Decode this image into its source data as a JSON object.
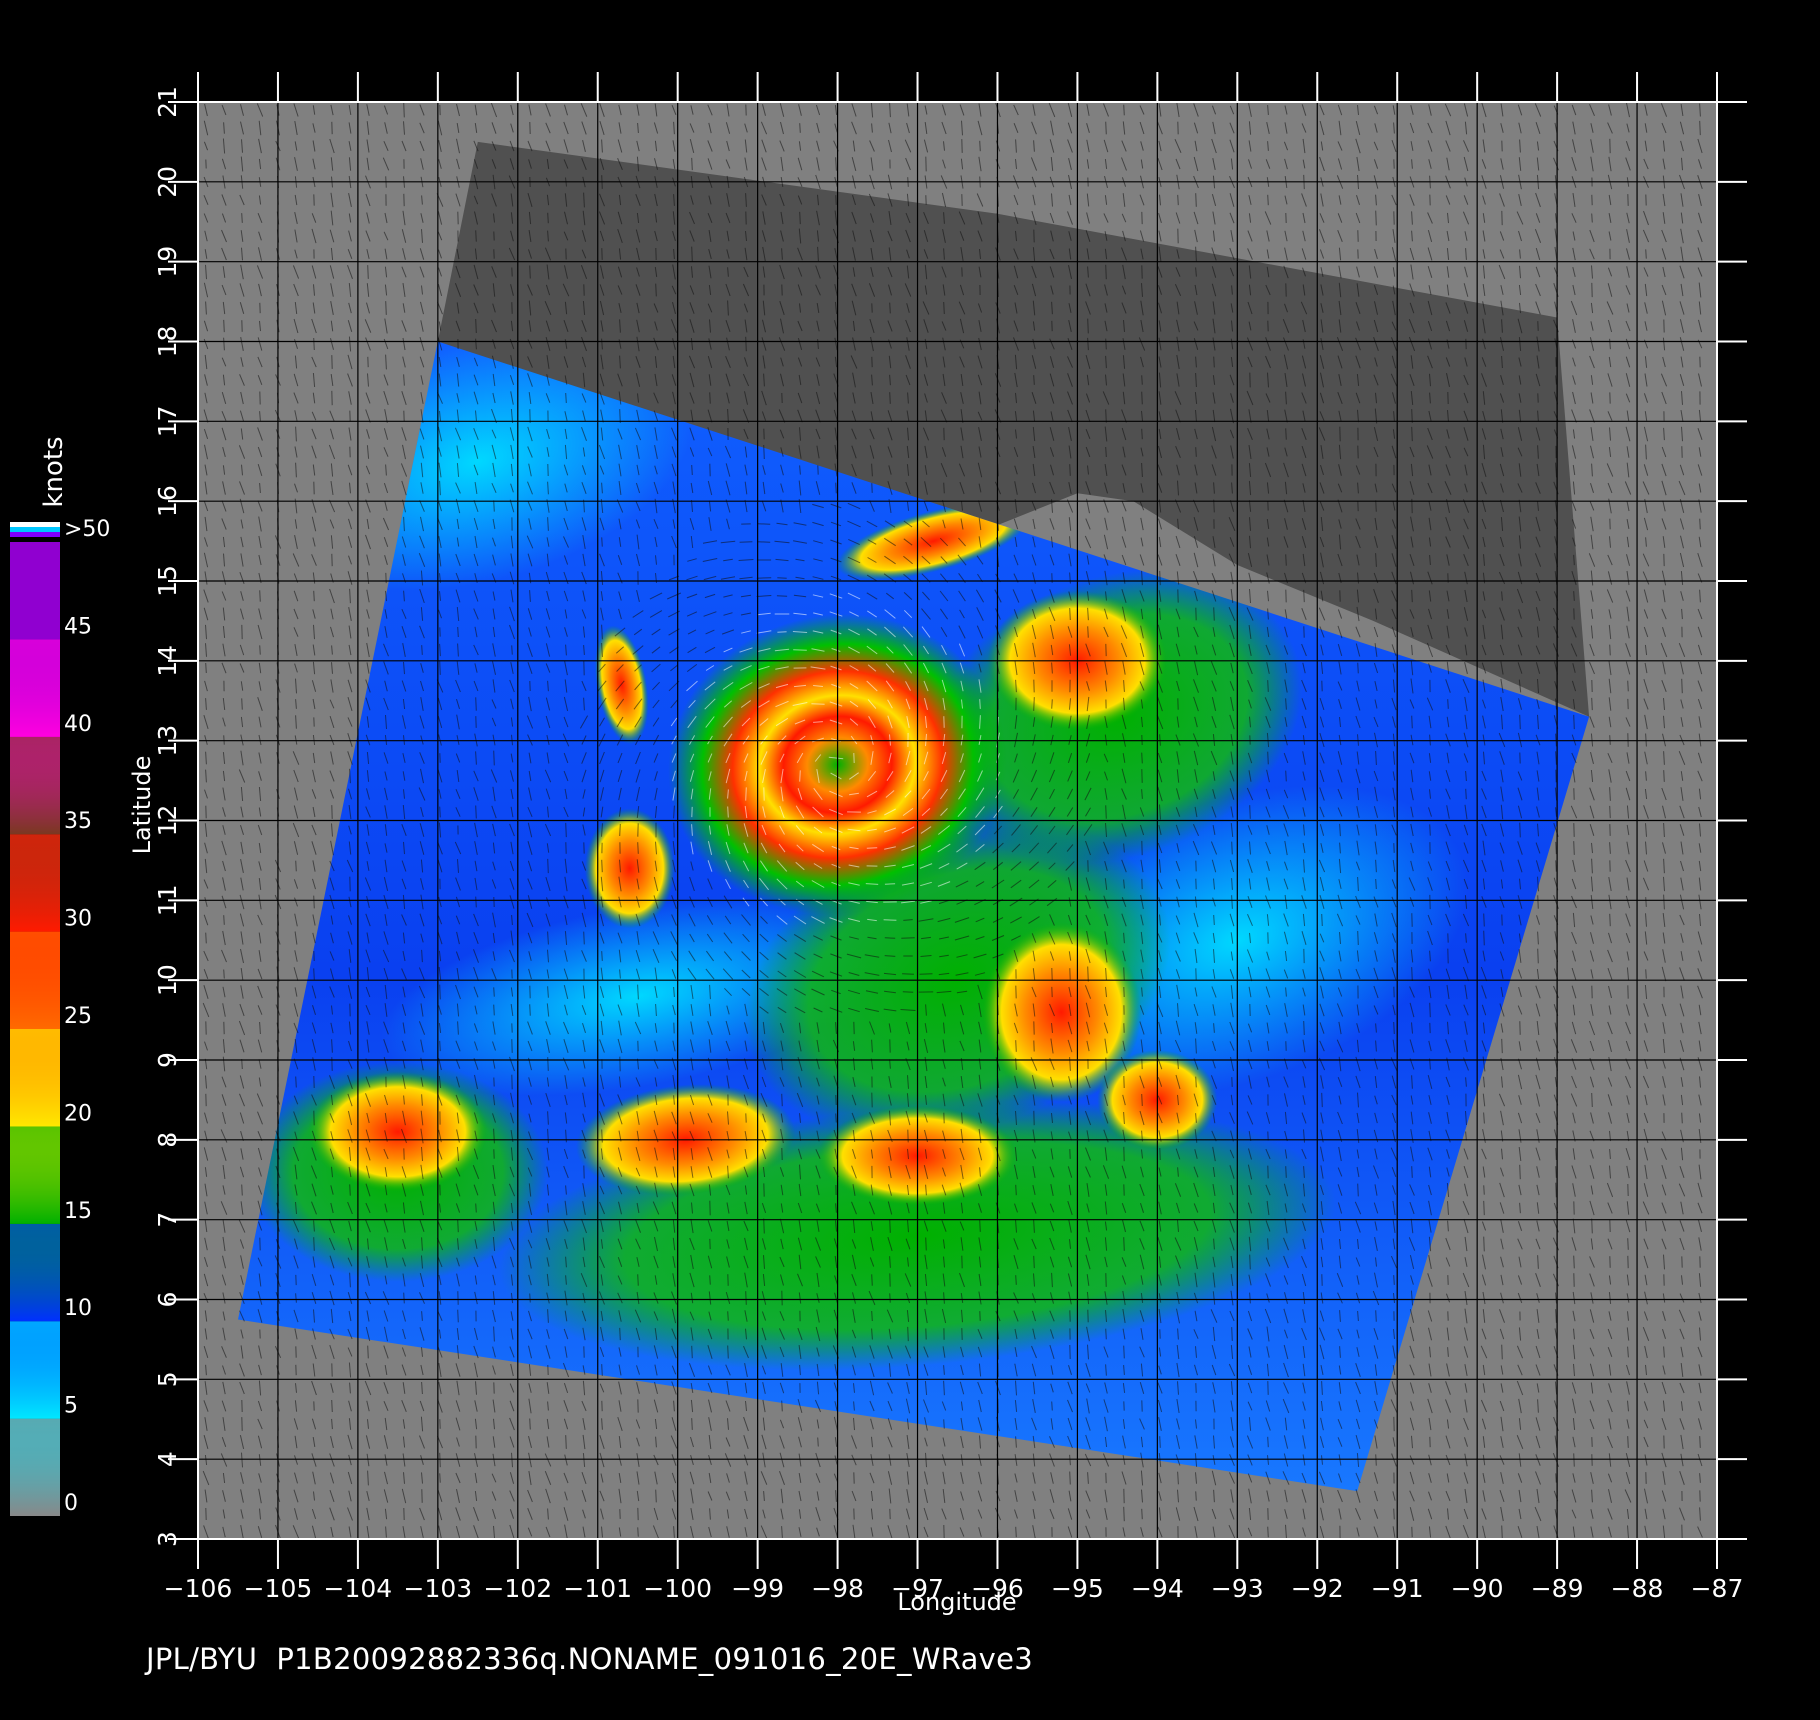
{
  "figure": {
    "x_axis_label": "Longitude",
    "y_axis_label": "Latitude",
    "longitude_ticks": [
      "−106",
      "−105",
      "−104",
      "−103",
      "−102",
      "−101",
      "−100",
      "−99",
      "−98",
      "−97",
      "−96",
      "−95",
      "−94",
      "−93",
      "−92",
      "−91",
      "−90",
      "−89",
      "−88",
      "−87"
    ],
    "latitude_ticks": [
      "3",
      "4",
      "5",
      "6",
      "7",
      "8",
      "9",
      "10",
      "11",
      "12",
      "13",
      "14",
      "15",
      "16",
      "17",
      "18",
      "19",
      "20",
      "21"
    ],
    "lon_range": [
      -106,
      -87
    ],
    "lat_range": [
      3,
      21
    ],
    "footer": "JPL/BYU  P1B20092882336q.NONAME_091016_20E_WRave3"
  },
  "colorbar": {
    "unit_label": "knots",
    "tick_labels": [
      "0",
      "5",
      "10",
      "15",
      "20",
      "25",
      "30",
      "35",
      "40",
      "45",
      ">50"
    ],
    "band_colors": [
      "#888888",
      "#00e8ff",
      "#0030ff",
      "#00b000",
      "#ffe800",
      "#ff6a00",
      "#ff1a00",
      "#7a3820",
      "#ff00e0",
      "#9000d0"
    ],
    "top_stripes": [
      "#ffffff",
      "#00c8ff",
      "#8000ff"
    ]
  },
  "map": {
    "background_color": "#808080",
    "land_color": "#505050",
    "grid_color": "#000000",
    "swath_corners_lonlat": [
      [
        -103.0,
        18.0
      ],
      [
        -88.6,
        13.3
      ],
      [
        -91.5,
        3.6
      ],
      [
        -105.5,
        5.75
      ]
    ],
    "land_polygon_lonlat": [
      [
        -102.5,
        20.5
      ],
      [
        -96.0,
        19.6
      ],
      [
        -89.0,
        18.3
      ],
      [
        -88.6,
        13.3
      ],
      [
        -91.3,
        14.5
      ],
      [
        -93.0,
        15.2
      ],
      [
        -94.3,
        16.0
      ],
      [
        -95.0,
        16.1
      ],
      [
        -96.0,
        15.7
      ],
      [
        -97.5,
        15.6
      ],
      [
        -99.0,
        16.1
      ],
      [
        -101.0,
        17.0
      ],
      [
        -102.6,
        17.7
      ],
      [
        -103.0,
        18.0
      ],
      [
        -102.5,
        20.5
      ]
    ],
    "storm_center_lonlat": [
      -98.0,
      12.7
    ]
  }
}
